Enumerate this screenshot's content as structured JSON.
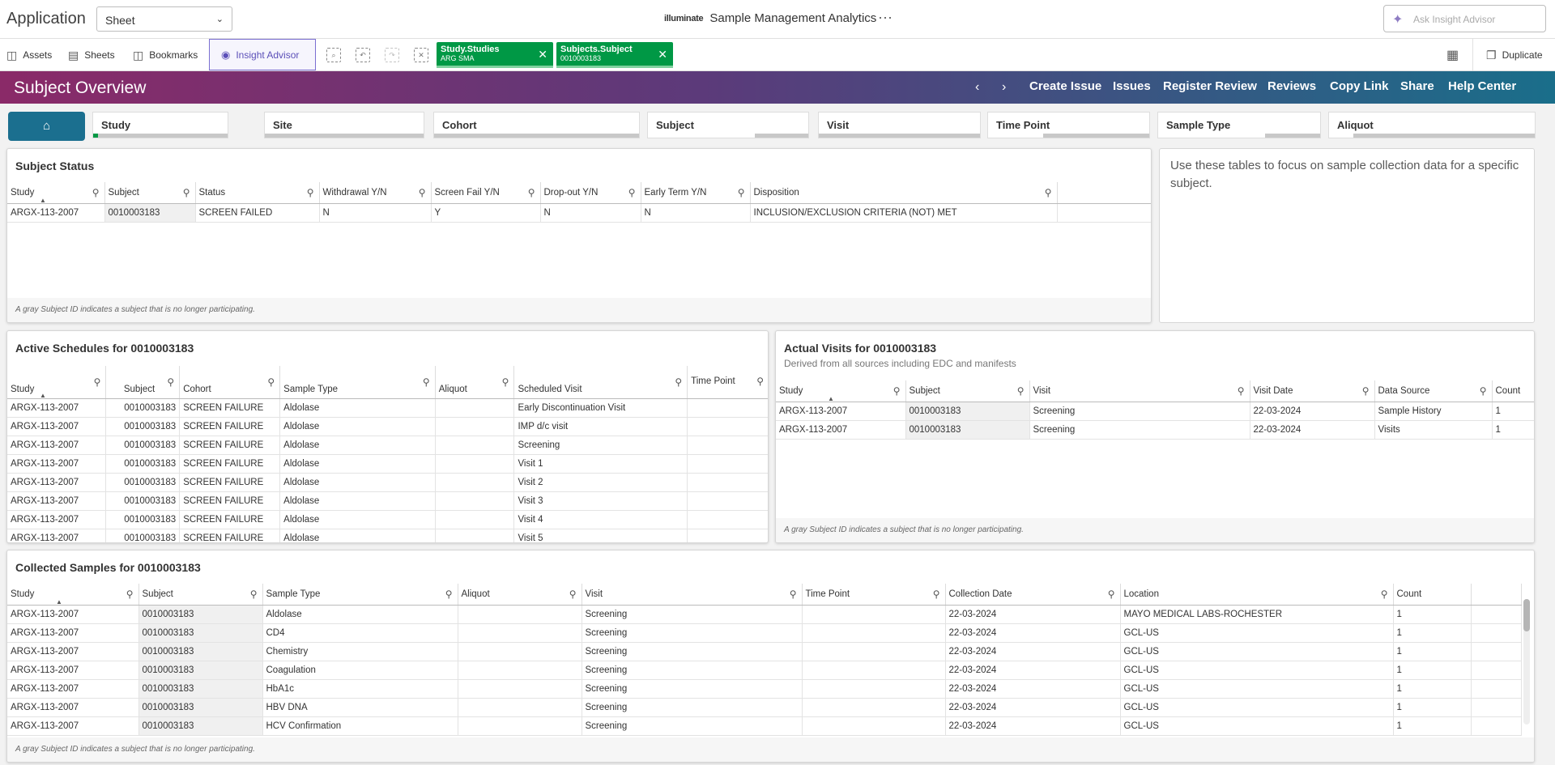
{
  "topbar": {
    "app_label": "Application",
    "sheet_select": "Sheet",
    "brand_logo": "illuminate",
    "brand_title": "Sample Management Analytics",
    "more": "···",
    "ask_placeholder": "Ask Insight Advisor"
  },
  "toolbar": {
    "assets": "Assets",
    "sheets": "Sheets",
    "bookmarks": "Bookmarks",
    "insight": "Insight Advisor",
    "duplicate": "Duplicate",
    "chips": [
      {
        "field": "Study.Studies",
        "value": "ARG SMA"
      },
      {
        "field": "Subjects.Subject",
        "value": "0010003183"
      }
    ]
  },
  "header": {
    "title": "Subject Overview",
    "links": [
      "Create Issue",
      "Issues",
      "Register Review",
      "Reviews",
      "Copy Link",
      "Share",
      "Help Center"
    ]
  },
  "filters": [
    "Study",
    "Site",
    "Cohort",
    "Subject",
    "Visit",
    "Time Point",
    "Sample Type",
    "Aliquot"
  ],
  "subject_status": {
    "title": "Subject Status",
    "columns": [
      "Study",
      "Subject",
      "Status",
      "Withdrawal Y/N",
      "Screen Fail Y/N",
      "Drop-out Y/N",
      "Early Term Y/N",
      "Disposition"
    ],
    "rows": [
      [
        "ARGX-113-2007",
        "0010003183",
        "SCREEN FAILED",
        "N",
        "Y",
        "N",
        "N",
        "INCLUSION/EXCLUSION CRITERIA (NOT) MET"
      ]
    ],
    "footnote": "A gray Subject ID indicates a subject that is no longer participating."
  },
  "info_text": "Use these tables to focus on sample collection data for a specific subject.",
  "active_schedules": {
    "title": "Active Schedules for 0010003183",
    "columns": [
      "Study",
      "Subject",
      "Cohort",
      "Sample Type",
      "Aliquot",
      "Scheduled Visit",
      "Time Point"
    ],
    "rows": [
      [
        "ARGX-113-2007",
        "0010003183",
        "SCREEN FAILURE",
        "Aldolase",
        "",
        "Early Discontinuation Visit",
        ""
      ],
      [
        "ARGX-113-2007",
        "0010003183",
        "SCREEN FAILURE",
        "Aldolase",
        "",
        "IMP d/c visit",
        ""
      ],
      [
        "ARGX-113-2007",
        "0010003183",
        "SCREEN FAILURE",
        "Aldolase",
        "",
        "Screening",
        ""
      ],
      [
        "ARGX-113-2007",
        "0010003183",
        "SCREEN FAILURE",
        "Aldolase",
        "",
        "Visit 1",
        ""
      ],
      [
        "ARGX-113-2007",
        "0010003183",
        "SCREEN FAILURE",
        "Aldolase",
        "",
        "Visit 2",
        ""
      ],
      [
        "ARGX-113-2007",
        "0010003183",
        "SCREEN FAILURE",
        "Aldolase",
        "",
        "Visit 3",
        ""
      ],
      [
        "ARGX-113-2007",
        "0010003183",
        "SCREEN FAILURE",
        "Aldolase",
        "",
        "Visit 4",
        ""
      ],
      [
        "ARGX-113-2007",
        "0010003183",
        "SCREEN FAILURE",
        "Aldolase",
        "",
        "Visit 5",
        ""
      ]
    ]
  },
  "actual_visits": {
    "title": "Actual Visits for 0010003183",
    "subtitle": "Derived from all sources including EDC and manifests",
    "columns": [
      "Study",
      "Subject",
      "Visit",
      "Visit Date",
      "Data Source",
      "Count"
    ],
    "rows": [
      [
        "ARGX-113-2007",
        "0010003183",
        "Screening",
        "22-03-2024",
        "Sample History",
        "1"
      ],
      [
        "ARGX-113-2007",
        "0010003183",
        "Screening",
        "22-03-2024",
        "Visits",
        "1"
      ]
    ],
    "footnote": "A gray Subject ID indicates a subject that is no longer participating."
  },
  "collected_samples": {
    "title": "Collected Samples for 0010003183",
    "columns": [
      "Study",
      "Subject",
      "Sample Type",
      "Aliquot",
      "Visit",
      "Time Point",
      "Collection Date",
      "Location",
      "Count"
    ],
    "rows": [
      [
        "ARGX-113-2007",
        "0010003183",
        "Aldolase",
        "",
        "Screening",
        "",
        "22-03-2024",
        "MAYO MEDICAL LABS-ROCHESTER",
        "1"
      ],
      [
        "ARGX-113-2007",
        "0010003183",
        "CD4",
        "",
        "Screening",
        "",
        "22-03-2024",
        "GCL-US",
        "1"
      ],
      [
        "ARGX-113-2007",
        "0010003183",
        "Chemistry",
        "",
        "Screening",
        "",
        "22-03-2024",
        "GCL-US",
        "1"
      ],
      [
        "ARGX-113-2007",
        "0010003183",
        "Coagulation",
        "",
        "Screening",
        "",
        "22-03-2024",
        "GCL-US",
        "1"
      ],
      [
        "ARGX-113-2007",
        "0010003183",
        "HbA1c",
        "",
        "Screening",
        "",
        "22-03-2024",
        "GCL-US",
        "1"
      ],
      [
        "ARGX-113-2007",
        "0010003183",
        "HBV DNA",
        "",
        "Screening",
        "",
        "22-03-2024",
        "GCL-US",
        "1"
      ],
      [
        "ARGX-113-2007",
        "0010003183",
        "HCV Confirmation",
        "",
        "Screening",
        "",
        "22-03-2024",
        "GCL-US",
        "1"
      ]
    ],
    "footnote": "A gray Subject ID indicates a subject that is no longer participating."
  }
}
